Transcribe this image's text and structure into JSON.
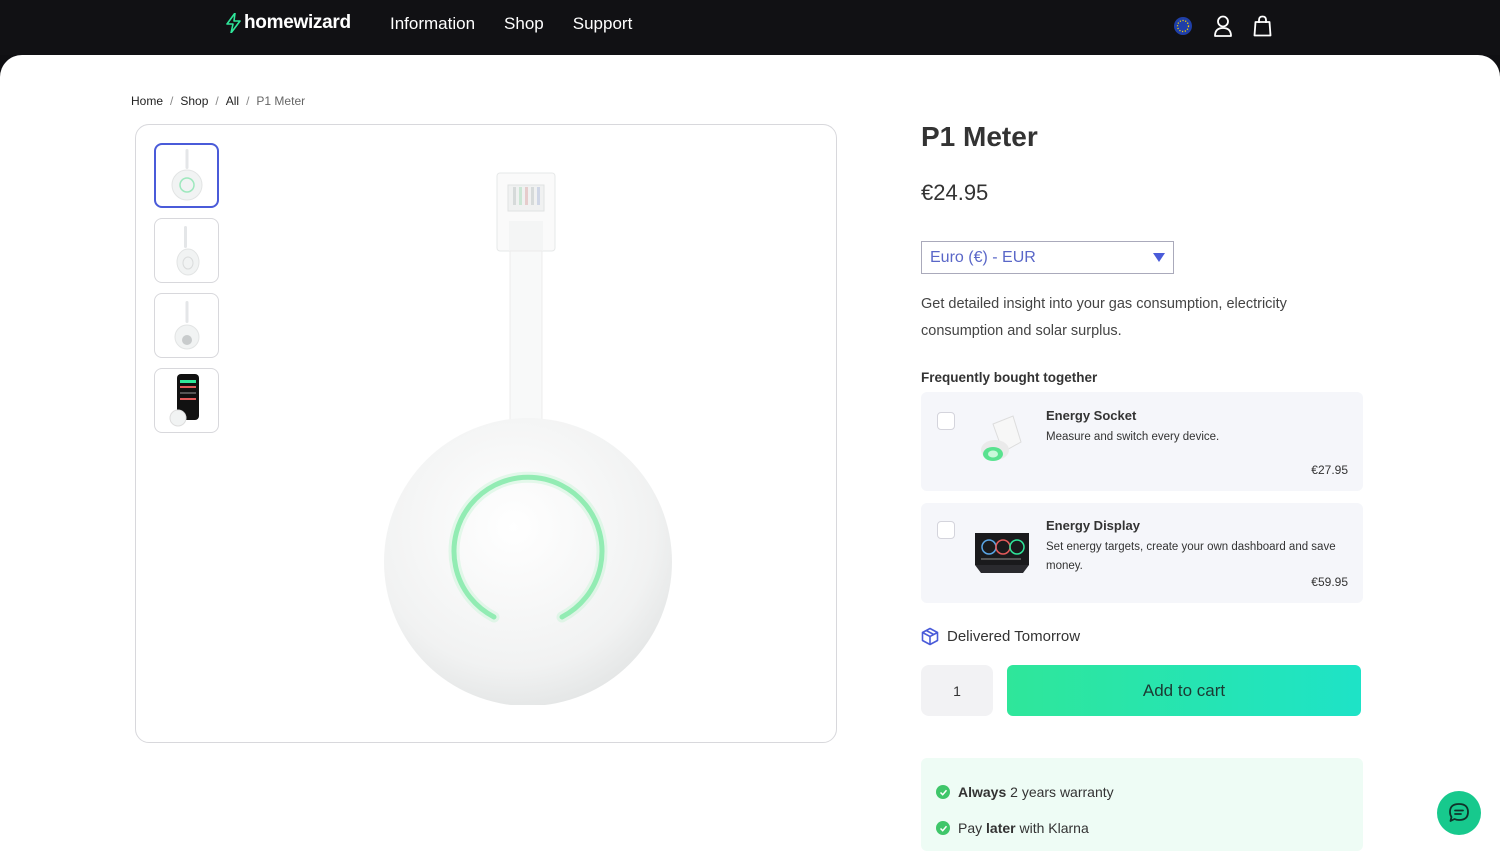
{
  "brand": {
    "name": "homewizard"
  },
  "nav": {
    "items": [
      "Information",
      "Shop",
      "Support"
    ]
  },
  "breadcrumb": {
    "home": "Home",
    "shop": "Shop",
    "all": "All",
    "current": "P1 Meter"
  },
  "product": {
    "title": "P1 Meter",
    "price": "€24.95",
    "currency_selected": "Euro (€) - EUR",
    "description": "Get detailed insight into your gas consumption, electricity consumption and solar surplus."
  },
  "fbt": {
    "title": "Frequently bought together",
    "items": [
      {
        "name": "Energy Socket",
        "desc": "Measure and switch every device.",
        "price": "€27.95"
      },
      {
        "name": "Energy Display",
        "desc": "Set energy targets, create your own dashboard and save money.",
        "price": "€59.95"
      }
    ]
  },
  "delivery": {
    "text": "Delivered Tomorrow"
  },
  "cart": {
    "quantity": "1",
    "add_label": "Add to cart"
  },
  "perks": [
    {
      "bold": "Always",
      "rest": " 2 years warranty"
    },
    {
      "pre": "Pay ",
      "bold": "later",
      "rest": " with Klarna"
    }
  ],
  "colors": {
    "accent": "#4a5bd9",
    "cta_start": "#2fe69a",
    "cta_end": "#1ee3c7",
    "check": "#3fc66a",
    "chat": "#17c98d"
  }
}
